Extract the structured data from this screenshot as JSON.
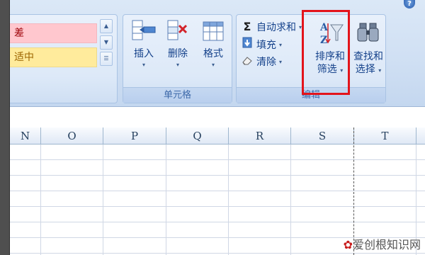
{
  "ribbon": {
    "cell_styles": {
      "bad": "差",
      "neutral": "适中"
    },
    "cells_group": {
      "label": "单元格",
      "insert": "插入",
      "delete": "删除",
      "format": "格式"
    },
    "editing_group": {
      "label": "编辑",
      "autosum": "自动求和",
      "fill": "填充",
      "clear": "清除",
      "sort_filter_line1": "排序和",
      "sort_filter_line2": "筛选",
      "find_select_line1": "查找和",
      "find_select_line2": "选择"
    },
    "highlight_color": "#e3141b"
  },
  "sheet": {
    "columns": [
      "N",
      "O",
      "P",
      "Q",
      "R",
      "S",
      "T"
    ]
  },
  "watermark": {
    "text": "爱创根知识网"
  },
  "colors": {
    "style_bad_bg": "#ffc7ce",
    "style_neutral_bg": "#ffeb9c",
    "ribbon_text": "#15428b"
  }
}
